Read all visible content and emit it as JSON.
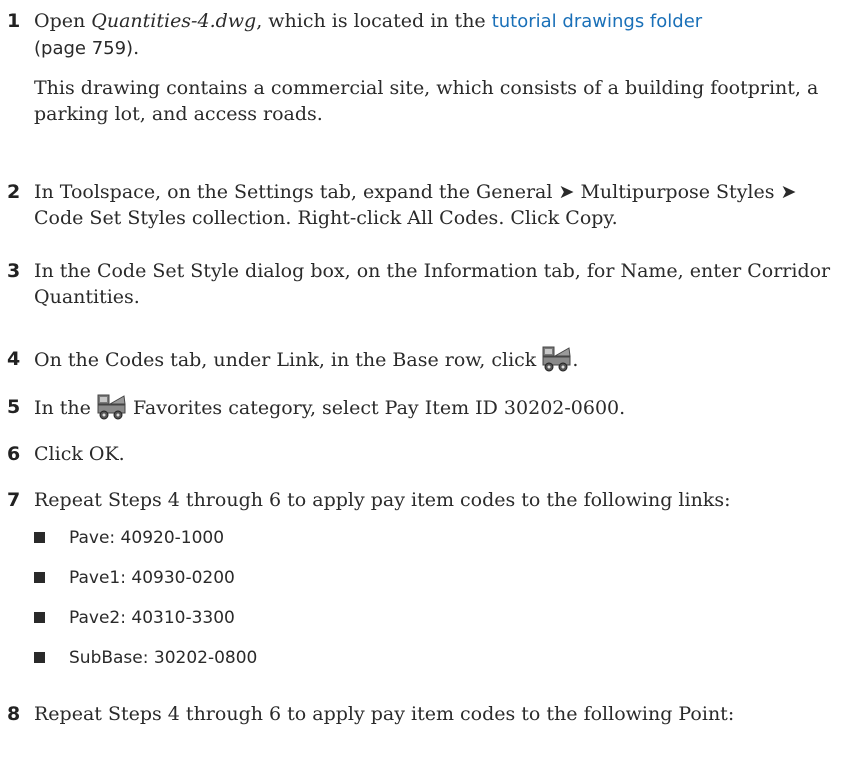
{
  "steps": [
    {
      "number": "1",
      "pre": "Open ",
      "filename": "Quantities-4.dwg",
      "mid": ", which is located in the ",
      "link": "tutorial drawings folder",
      "page_ref": "(page 759)",
      "page_ref_end": ".",
      "note": "This drawing contains a commercial site, which consists of a building footprint, a parking lot, and access roads."
    },
    {
      "number": "2",
      "text": "In Toolspace, on the Settings tab, expand the General ➤ Multipurpose Styles ➤ Code Set Styles collection. Right-click All Codes. Click Copy."
    },
    {
      "number": "3",
      "text": "In the Code Set Style dialog box, on the Information tab, for Name, enter Corridor Quantities."
    },
    {
      "number": "4",
      "text": "On the Codes tab, under Link, in the Base row, click",
      "text_end": "."
    },
    {
      "number": "5",
      "pre": "In the",
      "post": "Favorites category, select Pay Item ID 30202-0600."
    },
    {
      "number": "6",
      "text": "Click OK."
    },
    {
      "number": "7",
      "text": "Repeat Steps 4 through 6 to apply pay item codes to the following links:",
      "bullets": [
        "Pave: 40920-1000",
        "Pave1: 40930-0200",
        "Pave2: 40310-3300",
        "SubBase: 30202-0800"
      ]
    },
    {
      "number": "8",
      "text": "Repeat Steps 4 through 6 to apply pay item codes to the following Point:"
    }
  ],
  "icons": {
    "pay_item_icon": "pay-item-list-icon"
  },
  "colors": {
    "link": "#1a70b8",
    "text": "#2a2a2a"
  }
}
